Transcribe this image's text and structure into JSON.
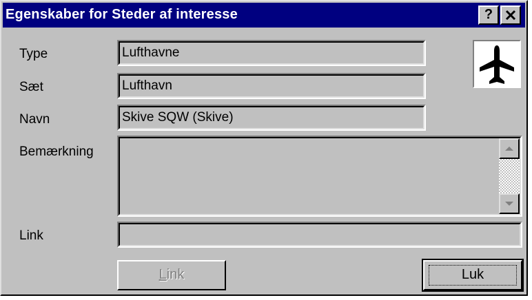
{
  "dialog": {
    "title": "Egenskaber for Steder af interesse",
    "help_button": "?",
    "close_button": "✕"
  },
  "fields": {
    "type": {
      "label": "Type",
      "value": "Lufthavne"
    },
    "set": {
      "label": "Sæt",
      "value": "Lufthavn"
    },
    "name": {
      "label": "Navn",
      "value": "Skive SQW (Skive)"
    },
    "remark": {
      "label": "Bemærkning",
      "value": ""
    },
    "link": {
      "label": "Link",
      "value": ""
    }
  },
  "icon": {
    "name": "airplane-icon"
  },
  "buttons": {
    "link": {
      "label": "Link",
      "mnemonic": "L",
      "rest": "ink",
      "enabled": false
    },
    "close": {
      "label": "Luk",
      "default": true
    }
  },
  "colors": {
    "titlebar": "#000080",
    "face": "#c0c0c0"
  }
}
